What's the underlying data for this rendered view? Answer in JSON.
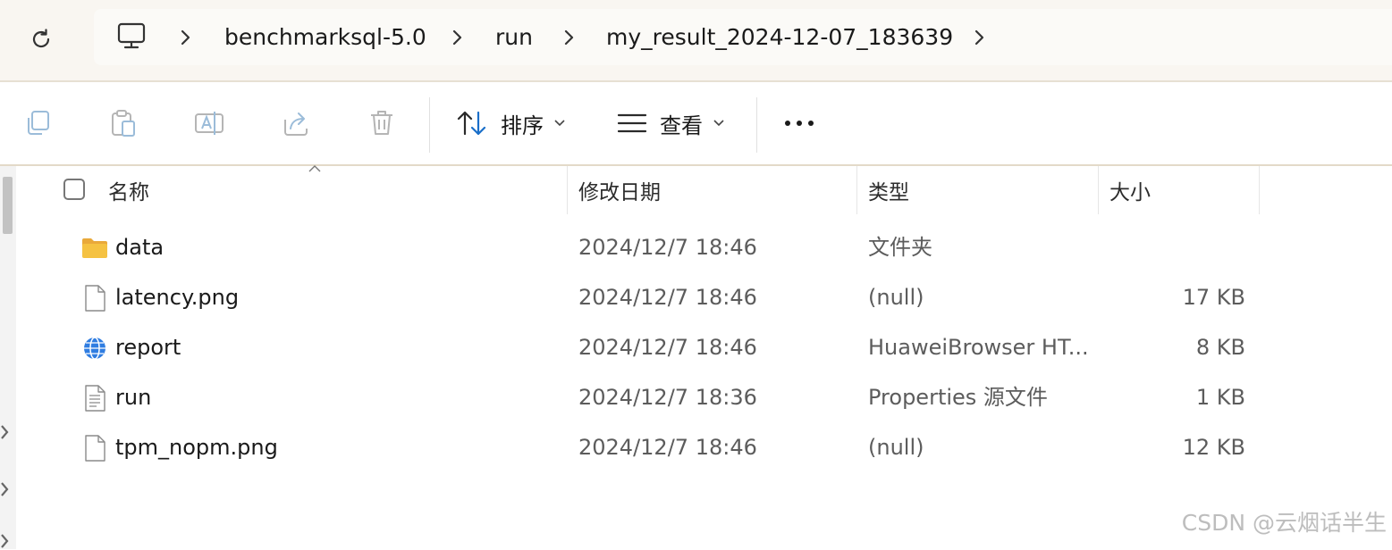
{
  "address_bar": {
    "computer_icon": "computer-icon",
    "breadcrumbs": [
      "benchmarksql-5.0",
      "run",
      "my_result_2024-12-07_183639"
    ]
  },
  "toolbar": {
    "icons": [
      "copy-icon",
      "paste-icon",
      "rename-icon",
      "share-icon",
      "delete-icon"
    ],
    "sort_label": "排序",
    "view_label": "查看",
    "more_label": "•••"
  },
  "columns": {
    "name": "名称",
    "modified": "修改日期",
    "type": "类型",
    "size": "大小"
  },
  "files": [
    {
      "icon": "folder-icon",
      "name": "data",
      "modified": "2024/12/7 18:46",
      "type": "文件夹",
      "size": ""
    },
    {
      "icon": "file-icon",
      "name": "latency.png",
      "modified": "2024/12/7 18:46",
      "type": "(null)",
      "size": "17 KB"
    },
    {
      "icon": "browser-icon",
      "name": "report",
      "modified": "2024/12/7 18:46",
      "type": "HuaweiBrowser HT...",
      "size": "8 KB"
    },
    {
      "icon": "text-file-icon",
      "name": "run",
      "modified": "2024/12/7 18:36",
      "type": "Properties 源文件",
      "size": "1 KB"
    },
    {
      "icon": "file-icon",
      "name": "tpm_nopm.png",
      "modified": "2024/12/7 18:46",
      "type": "(null)",
      "size": "12 KB"
    }
  ],
  "watermark": "CSDN @云烟话半生",
  "colors": {
    "address_bg": "#f9f6f1",
    "accent_blue": "#1a6fc9",
    "folder_yellow": "#f5c242"
  }
}
